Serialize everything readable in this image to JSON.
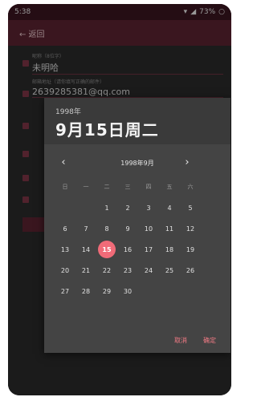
{
  "status": {
    "time": "5:38",
    "battery": "73%"
  },
  "appbar": {
    "back_label": "← 返回"
  },
  "form": {
    "name_hint": "昵称（8位字）",
    "name_value": "未明哈",
    "email_hint": "邮箱地址（请你填写正确的邮件）",
    "email_value": "2639285381@qq.com"
  },
  "picker": {
    "year": "1998年",
    "selected_label": "9月15日周二",
    "month_title": "1998年9月",
    "prev_icon": "chevron-left-icon",
    "next_icon": "chevron-right-icon",
    "weekdays": [
      "日",
      "一",
      "二",
      "三",
      "四",
      "五",
      "六"
    ],
    "leading_blanks": 2,
    "days": [
      "1",
      "2",
      "3",
      "4",
      "5",
      "6",
      "7",
      "8",
      "9",
      "10",
      "11",
      "12",
      "13",
      "14",
      "15",
      "16",
      "17",
      "18",
      "19",
      "20",
      "21",
      "22",
      "23",
      "24",
      "25",
      "26",
      "27",
      "28",
      "29",
      "30"
    ],
    "selected_day": "15",
    "cancel_label": "取消",
    "ok_label": "确定"
  },
  "colors": {
    "accent": "#f06b78",
    "appbar": "#5a2230",
    "dialog": "#444444"
  }
}
